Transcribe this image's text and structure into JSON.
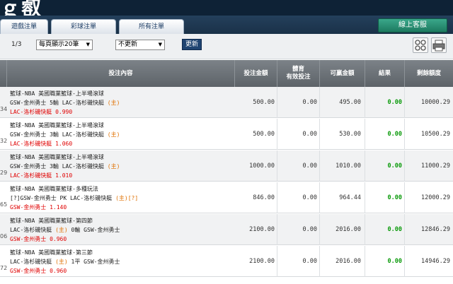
{
  "header": {
    "logo_fragment": "ｇ㕡",
    "tabs": [
      "遊戲注單",
      "彩球注單",
      "所有注單"
    ],
    "online_service": "線上客服"
  },
  "toolbar": {
    "page_info": "1/3",
    "per_page": "每頁顯示20筆",
    "refresh_mode": "不更新",
    "update_button": "更新"
  },
  "table": {
    "columns": [
      "投注內容",
      "投注金額",
      "體育\n有效投注",
      "可贏金額",
      "結果",
      "剩餘額度"
    ],
    "rows": [
      {
        "id": "34",
        "line1": "籃球-NBA 美國職業籃球-上半場滾球",
        "line2a": "GSW-金州勇士  5輸  LAC-洛杉磯快艇 ",
        "line2b": "(主)",
        "line3": "LAC-洛杉磯快艇 0.990",
        "amount": "500.00",
        "valid": "0.00",
        "win": "495.00",
        "result": "0.00",
        "balance": "10000.29"
      },
      {
        "id": "32",
        "line1": "籃球-NBA 美國職業籃球-上半場滾球",
        "line2a": "GSW-金州勇士  3輸  LAC-洛杉磯快艇 ",
        "line2b": "(主)",
        "line3": "LAC-洛杉磯快艇 1.060",
        "amount": "500.00",
        "valid": "0.00",
        "win": "530.00",
        "result": "0.00",
        "balance": "10500.29"
      },
      {
        "id": "29",
        "line1": "籃球-NBA 美國職業籃球-上半場滾球",
        "line2a": "GSW-金州勇士  3輸  LAC-洛杉磯快艇 ",
        "line2b": "(主)",
        "line3": "LAC-洛杉磯快艇 1.010",
        "amount": "1000.00",
        "valid": "0.00",
        "win": "1010.00",
        "result": "0.00",
        "balance": "11000.29"
      },
      {
        "id": "65",
        "line1": "籃球-NBA 美國職業籃球-多種玩法",
        "line2a": "[?]GSW-金州勇士  PK  LAC-洛杉磯快艇 ",
        "line2b": "(主)[?]",
        "line3": "GSW-金州勇士 1.140",
        "amount": "846.00",
        "valid": "0.00",
        "win": "964.44",
        "result": "0.00",
        "balance": "12000.29"
      },
      {
        "id": "06",
        "line1": "籃球-NBA 美國職業籃球-第四節",
        "line2a": "LAC-洛杉磯快艇 ",
        "line2b": "(主)",
        "line2c": "  0輸  GSW-金州勇士",
        "line3": "GSW-金州勇士 0.960",
        "amount": "2100.00",
        "valid": "0.00",
        "win": "2016.00",
        "result": "0.00",
        "balance": "12846.29"
      },
      {
        "id": "72",
        "line1": "籃球-NBA 美國職業籃球-第三節",
        "line2a": "LAC-洛杉磯快艇 ",
        "line2b": "(主)",
        "line2c": "  1平  GSW-金州勇士",
        "line3": "GSW-金州勇士 0.960",
        "amount": "2100.00",
        "valid": "0.00",
        "win": "2016.00",
        "result": "0.00",
        "balance": "14946.29"
      }
    ]
  }
}
